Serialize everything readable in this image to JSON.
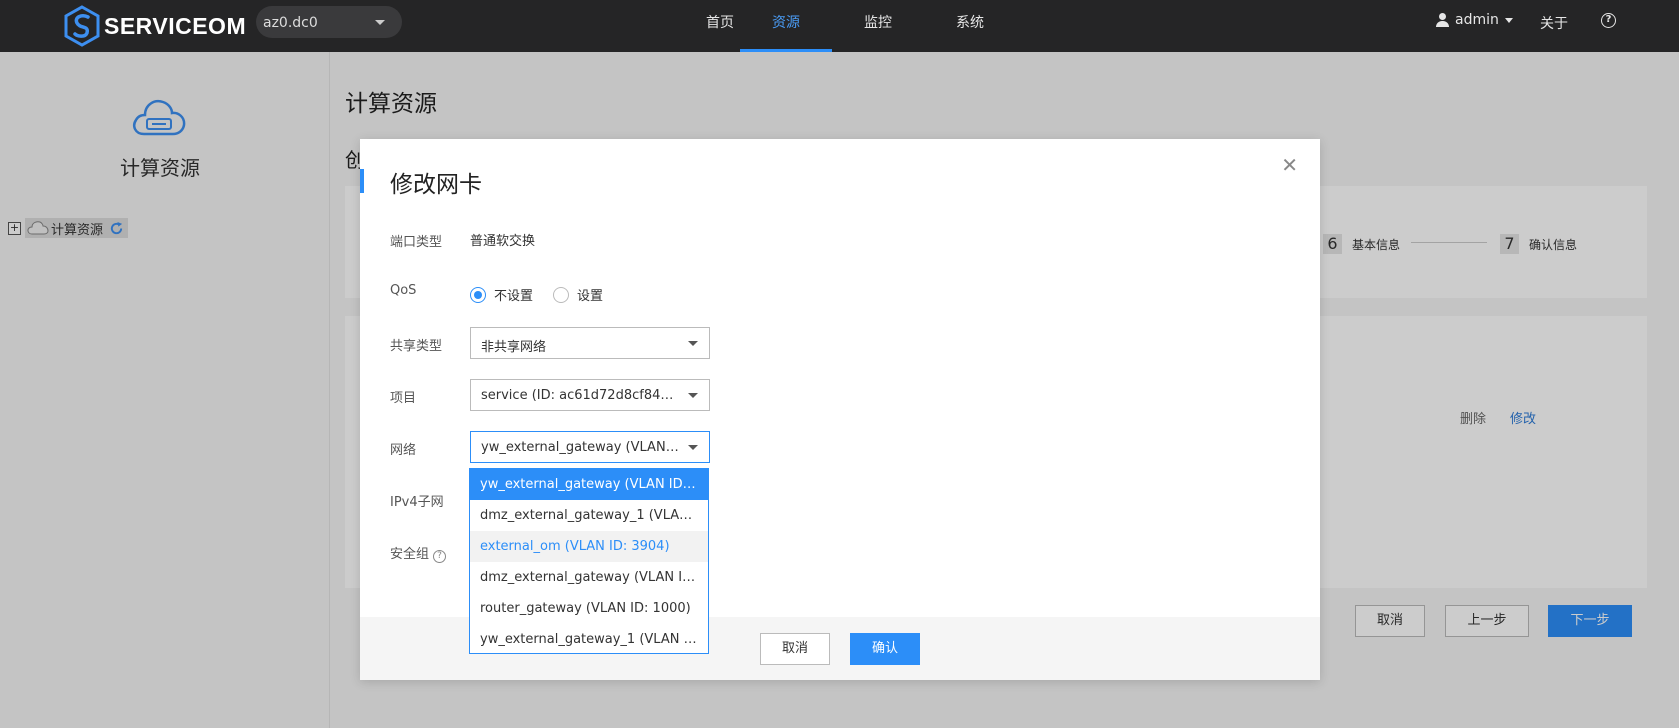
{
  "header": {
    "logo_text": "SERVICEOM",
    "az_value": "az0.dc0",
    "nav": [
      {
        "label": "首页",
        "active": false
      },
      {
        "label": "资源",
        "active": true
      },
      {
        "label": "监控",
        "active": false
      },
      {
        "label": "系统",
        "active": false
      }
    ],
    "user": "admin",
    "about": "关于",
    "help": "?"
  },
  "sidebar": {
    "title": "计算资源",
    "tree_node_label": "计算资源"
  },
  "main": {
    "title": "计算资源",
    "subtitle": "创",
    "steps": [
      {
        "num": "6",
        "label": "基本信息"
      },
      {
        "num": "7",
        "label": "确认信息"
      }
    ],
    "row_actions": {
      "delete": "删除",
      "edit": "修改"
    },
    "buttons": {
      "cancel": "取消",
      "prev": "上一步",
      "next": "下一步"
    }
  },
  "modal": {
    "title": "修改网卡",
    "fields": {
      "port_type": {
        "label": "端口类型",
        "value": "普通软交换"
      },
      "qos": {
        "label": "QoS",
        "options": [
          "不设置",
          "设置"
        ],
        "selected": "不设置"
      },
      "share_type": {
        "label": "共享类型",
        "value": "非共享网络"
      },
      "project": {
        "label": "项目",
        "value": "service (ID: ac61d72d8cf84cc..."
      },
      "network": {
        "label": "网络",
        "value": "yw_external_gateway (VLAN I..."
      },
      "ipv4_subnet": {
        "label": "IPv4子网"
      },
      "security_group": {
        "label": "安全组"
      }
    },
    "network_options": [
      "yw_external_gateway (VLAN ID: ...",
      "dmz_external_gateway_1 (VLAN ...",
      "external_om (VLAN ID: 3904)",
      "dmz_external_gateway (VLAN ID:...",
      "router_gateway (VLAN ID: 1000)",
      "yw_external_gateway_1 (VLAN ID..."
    ],
    "buttons": {
      "cancel": "取消",
      "confirm": "确认"
    }
  },
  "colors": {
    "accent": "#2c8ef8",
    "topbar": "#252526"
  }
}
